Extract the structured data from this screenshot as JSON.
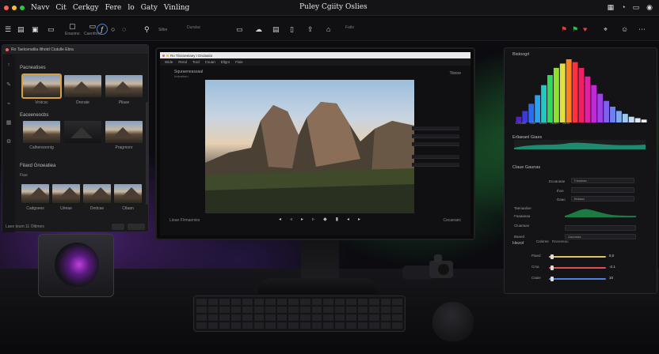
{
  "menubar": {
    "traffic_light_colors": [
      "#ff5f56",
      "#ffbd2e",
      "#27c93f"
    ],
    "menus": [
      "Navv",
      "Cit",
      "Cerkgy",
      "Fere",
      "lo",
      "Gaty",
      "Vinling"
    ],
    "app_title": "Puley Cgiity Oslies",
    "right_icons": [
      "grid-icon",
      "wifi-icon",
      "battery-icon",
      "user-icon"
    ]
  },
  "toolbar": {
    "left_buttons": [
      {
        "icon": "sidebar-icon",
        "label": ""
      },
      {
        "icon": "folder-icon",
        "label": ""
      },
      {
        "icon": "import-icon",
        "label": ""
      },
      {
        "icon": "camera-icon",
        "label": ""
      },
      {
        "icon": "browse-icon",
        "label": ""
      },
      {
        "icon": "window-icon",
        "label": ""
      },
      {
        "icon": "edit-icon",
        "label": ""
      },
      {
        "icon": "crop-icon",
        "label": ""
      },
      {
        "icon": "heal-icon",
        "label": ""
      }
    ],
    "small_labels": [
      "Enaome",
      "Caenfreiv",
      "Siltre"
    ],
    "center_label": "Duralac",
    "right_label": "Fatle"
  },
  "left_panel": {
    "window_title": "Ro Taelcenatlia ilthotd Ciutulle Ebra",
    "section_1": "Pacneatises",
    "section_1_labels": [
      "Vrotcsc",
      "Drerate",
      "Pliase"
    ],
    "section_2": "Eaceeneocbs",
    "section_2_labels": [
      "Calhensonnig",
      "",
      "Pragmonr"
    ],
    "section_3": "Filaxd Gnoeatiea",
    "section_3_sub": "Fiae",
    "section_4_labels": [
      "Cadgsees",
      "Uireae",
      "Dodcae",
      "Ctlaan"
    ],
    "footer": "Laee teum 11 Ottimes"
  },
  "screen": {
    "title": "Ro Tiiscseeiaey I Drulaaiia",
    "menus": [
      "Wide",
      "Rend",
      "Tord",
      "Csuan",
      "Ellgrs",
      "Fisie"
    ],
    "sub_title": "Squraeneassaal",
    "sub_info": "Ireieaibeu",
    "right_info": "Tiiiooe",
    "bottom_left": "Lieae Flrmaenies",
    "bottom_right": "Cecaeaec",
    "transport": [
      "◂",
      "◃",
      "▸",
      "▹",
      "◆",
      "▮",
      "◂",
      "▸"
    ]
  },
  "right_panel": {
    "histogram_title": "Bistoogrl",
    "histogram": {
      "values": [
        8,
        16,
        26,
        38,
        52,
        66,
        76,
        82,
        88,
        84,
        76,
        64,
        52,
        40,
        30,
        22,
        16,
        12,
        8,
        6,
        4
      ],
      "colors": [
        "#5020c8",
        "#3a38e0",
        "#2a6cf0",
        "#2aa0ee",
        "#20c8c0",
        "#30d860",
        "#90e030",
        "#e0e040",
        "#ff8020",
        "#ff3040",
        "#f02060",
        "#e020a0",
        "#c028d8",
        "#a040e8",
        "#8060f0",
        "#7080f0",
        "#80a8ee",
        "#a0c8ee",
        "#c8d8ee",
        "#dde6ee",
        "#eef2f6"
      ],
      "axis_labels": [
        "Leoaie",
        "",
        "Nfie",
        "Seee",
        "Naen",
        "Sthn"
      ]
    },
    "curve_title": "Erliaeanl Giaes",
    "color_title": "Claue Gaunas",
    "rows": [
      {
        "label": "",
        "sub": "Ecuauaae",
        "value": "Fauseaa"
      },
      {
        "label": "",
        "sub": "Ihoe",
        "value": ""
      },
      {
        "label": "",
        "sub": "Daao",
        "value": "Bntaad"
      },
      {
        "label": "Taenaalioe",
        "sub": "",
        "value": ""
      },
      {
        "label": "Faaaaeaa",
        "sub": "",
        "value": ""
      },
      {
        "label": "Cluaeaao",
        "sub": "",
        "value": ""
      },
      {
        "label": "Baeed",
        "sub": "",
        "value": "Gauneaa"
      },
      {
        "label": "Calorne",
        "sub": "",
        "value": "Raceeeau"
      }
    ],
    "hsl_title": "Hezol",
    "hsl": [
      {
        "label": "Piaed",
        "value": "8,0",
        "color": "#e0c060"
      },
      {
        "label": "Crsa",
        "value": "-2.1",
        "color": "#e05050"
      },
      {
        "label": "Caaie",
        "value": "10",
        "color": "#5080e0"
      }
    ]
  }
}
